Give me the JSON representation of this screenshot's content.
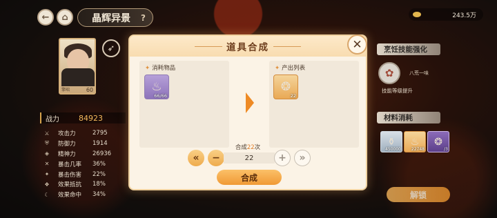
{
  "header": {
    "back_icon": "back-arrow-icon",
    "home_icon": "home-icon",
    "title": "晶辉异景",
    "help": "?",
    "currency_value": "243.5万"
  },
  "character": {
    "name": "擎昭",
    "level": "60",
    "power_label": "战力",
    "power_value": "84923",
    "stats": [
      {
        "icon": "sword-icon",
        "name": "攻击力",
        "value": "2795"
      },
      {
        "icon": "shield-icon",
        "name": "防御力",
        "value": "1914"
      },
      {
        "icon": "spirit-icon",
        "name": "精神力",
        "value": "26936"
      },
      {
        "icon": "crit-rate-icon",
        "name": "暴击几率",
        "value": "36%"
      },
      {
        "icon": "crit-dmg-icon",
        "name": "暴击伤害",
        "value": "22%"
      },
      {
        "icon": "resist-icon",
        "name": "效果抵抗",
        "value": "18%"
      },
      {
        "icon": "accuracy-icon",
        "name": "效果命中",
        "value": "34%"
      }
    ]
  },
  "right_panel": {
    "skill_section_title": "烹饪技能强化",
    "skill_name": "八荒一味",
    "skill_desc": "技能等级提升",
    "materials_title": "材料消耗",
    "materials": [
      {
        "icon": "potion-icon",
        "count": "450000"
      },
      {
        "icon": "fire-gem-icon",
        "count": "22748"
      },
      {
        "icon": "crystal-icon",
        "count": "/3"
      }
    ],
    "unlock_label": "解锁"
  },
  "modal": {
    "title": "道具合成",
    "input_label": "消耗物品",
    "input_item": {
      "icon": "fire-gem-icon",
      "count": "66/66"
    },
    "output_label": "产出列表",
    "output_item": {
      "icon": "ornate-gem-icon",
      "count": "22"
    },
    "count_prefix": "合成",
    "count_num": "22",
    "count_suffix": "次",
    "quantity": "22",
    "min_label": "«",
    "minus_label": "−",
    "plus_label": "+",
    "max_label": "»",
    "synth_label": "合成",
    "close_label": "✕"
  }
}
